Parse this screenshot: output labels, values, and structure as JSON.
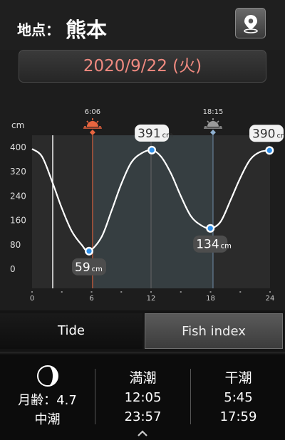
{
  "location": {
    "label": "地点：",
    "name": "熊本"
  },
  "date": "2020/9/22 (火)",
  "chart_data": {
    "type": "line",
    "unit_label": "cm",
    "yticks": [
      "400",
      "320",
      "240",
      "160",
      "80",
      "0"
    ],
    "xticks": [
      "0",
      "6",
      "12",
      "18",
      "24"
    ],
    "ylim": [
      0,
      400
    ],
    "xlim": [
      0,
      24
    ],
    "sunrise": "6:06",
    "sunset": "18:15",
    "x": [
      0,
      1,
      2,
      3,
      4,
      5,
      5.75,
      7,
      8,
      9,
      10,
      11,
      12.08,
      13,
      14,
      15,
      16,
      17,
      17.98,
      19,
      20,
      21,
      22,
      23,
      23.95
    ],
    "y": [
      395,
      370,
      290,
      200,
      125,
      80,
      59,
      105,
      190,
      280,
      350,
      380,
      391,
      370,
      315,
      240,
      175,
      145,
      134,
      155,
      225,
      300,
      360,
      385,
      390
    ],
    "extremes": [
      {
        "x": 5.75,
        "y": 59,
        "label": "59",
        "unit": "cm"
      },
      {
        "x": 12.08,
        "y": 391,
        "label": "391",
        "unit": "cm"
      },
      {
        "x": 17.98,
        "y": 134,
        "label": "134",
        "unit": "cm"
      },
      {
        "x": 23.95,
        "y": 390,
        "label": "390",
        "unit": "cm"
      }
    ]
  },
  "tabs": {
    "tide": "Tide",
    "fish": "Fish index"
  },
  "info": {
    "moon_age": "月齢：4.7",
    "tide_name": "中潮",
    "high": {
      "title": "満潮",
      "t1": "12:05",
      "t2": "23:57"
    },
    "low": {
      "title": "干潮",
      "t1": "5:45",
      "t2": "17:59"
    }
  },
  "colors": {
    "date_text": "#f08a80",
    "sunrise": "#e8653f",
    "sunset": "#8fb0d0",
    "marker": "#2f8fe8"
  }
}
